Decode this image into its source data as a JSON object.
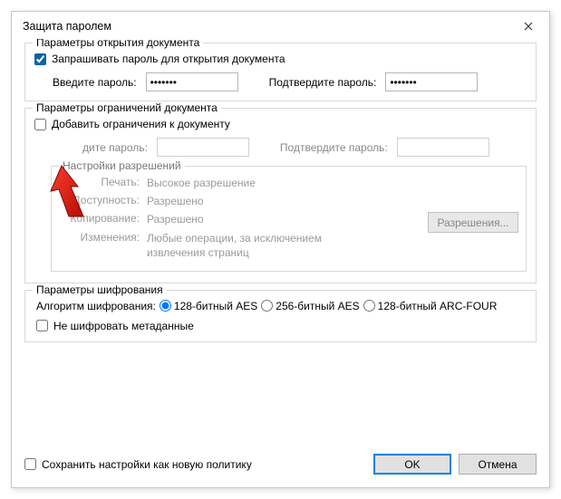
{
  "title": "Защита паролем",
  "groups": {
    "open": {
      "title": "Параметры открытия документа",
      "require_pw_label": "Запрашивать пароль для открытия документа",
      "require_pw_checked": true,
      "enter_pw": "Введите пароль:",
      "confirm_pw": "Подтвердите пароль:",
      "pw_value": "•••••••"
    },
    "restrict": {
      "title": "Параметры ограничений документа",
      "add_restrictions_label": "Добавить ограничения к документу",
      "add_restrictions_checked": false,
      "enter_pw": "дите пароль:",
      "confirm_pw": "Подтвердите пароль:",
      "perm_group_title": "Настройки разрешений",
      "perm": {
        "print_label": "Печать:",
        "print_value": "Высокое разрешение",
        "access_label": "Доступность:",
        "access_value": "Разрешено",
        "copy_label": "Копирование:",
        "copy_value": "Разрешено",
        "changes_label": "Изменения:",
        "changes_value": "Любые операции, за исключением извлечения страниц"
      },
      "perm_button": "Разрешения..."
    },
    "encrypt": {
      "title": "Параметры шифрования",
      "algo_label": "Алгоритм шифрования:",
      "opt1": "128-битный AES",
      "opt2": "256-битный AES",
      "opt3": "128-битный ARC-FOUR",
      "selected": "opt1",
      "no_encrypt_meta": "Не шифровать метаданные",
      "no_encrypt_meta_checked": false
    }
  },
  "bottom": {
    "save_policy": "Сохранить настройки как новую политику",
    "save_policy_checked": false,
    "ok": "OK",
    "cancel": "Отмена"
  }
}
